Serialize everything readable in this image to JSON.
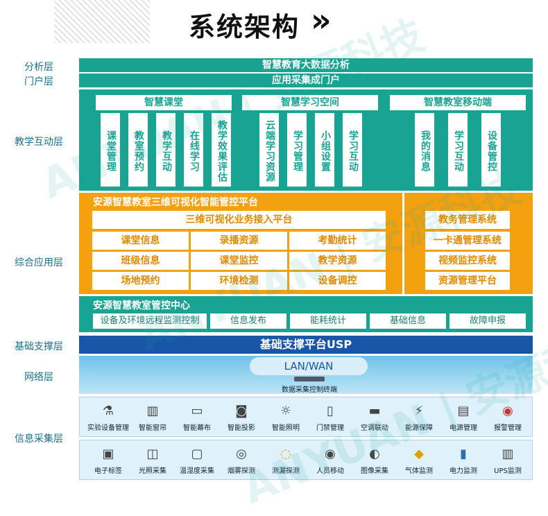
{
  "title": "系统架构",
  "title_arrow": "»",
  "watermark": "ANYUAN | 安源科技",
  "layers": {
    "analysis": "分析层",
    "portal": "门户层",
    "teaching": "教学互动层",
    "app": "综合应用层",
    "base": "基础支撑层",
    "network": "网络层",
    "info": "信息采集层"
  },
  "analysis_bar": "智慧教育大数据分析",
  "portal_bar": "应用采集成门户",
  "teaching": {
    "groups": [
      {
        "title": "智慧课堂",
        "items": [
          "课堂管理",
          "教室预约",
          "教学互动",
          "在线学习",
          "教学效果评估"
        ]
      },
      {
        "title": "智慧学习空间",
        "items": [
          "云端学习资源",
          "学习管理",
          "小组设置",
          "学习互动"
        ]
      },
      {
        "title": "智慧教室移动端",
        "items": [
          "我的消息",
          "学习互动",
          "设备管控"
        ]
      }
    ]
  },
  "platform3d": {
    "title": "安源智慧教室三维可视化智能管控平台",
    "access": "三维可视化业务接入平台",
    "grid": [
      [
        "课堂信息",
        "录播资源",
        "考勤统计"
      ],
      [
        "班级信息",
        "课堂监控",
        "教学资源"
      ],
      [
        "场地预约",
        "环境检测",
        "设备调控"
      ]
    ],
    "systems": [
      "教务管理系统",
      "一卡通管理系统",
      "视频监控系统",
      "资源管理平台"
    ]
  },
  "control_center": {
    "title": "安源智慧教室管控中心",
    "items": [
      "设备及环境远程监测控制",
      "信息发布",
      "能耗统计",
      "基础信息",
      "故障申报"
    ]
  },
  "usp": "基础支撑平台USP",
  "network": {
    "lan": "LAN/WAN",
    "terminal": "数据采集控制终端"
  },
  "devices_row1": [
    {
      "label": "实验设备管理",
      "icon": "lab-icon"
    },
    {
      "label": "智能窗帘",
      "icon": "curtain-icon"
    },
    {
      "label": "智能幕布",
      "icon": "screen-icon"
    },
    {
      "label": "智能投影",
      "icon": "projector-icon"
    },
    {
      "label": "智能照明",
      "icon": "light-icon"
    },
    {
      "label": "门禁管理",
      "icon": "door-icon"
    },
    {
      "label": "空调联动",
      "icon": "aircon-icon"
    },
    {
      "label": "能源保障",
      "icon": "energy-icon"
    },
    {
      "label": "电源管理",
      "icon": "power-icon"
    },
    {
      "label": "报警管理",
      "icon": "alarm-icon"
    }
  ],
  "devices_row2": [
    {
      "label": "电子标签",
      "icon": "tag-icon"
    },
    {
      "label": "光照采集",
      "icon": "light-sensor-icon"
    },
    {
      "label": "温湿度采集",
      "icon": "thermo-icon"
    },
    {
      "label": "烟雾探测",
      "icon": "smoke-icon"
    },
    {
      "label": "测漏探测",
      "icon": "leak-icon"
    },
    {
      "label": "人员移动",
      "icon": "motion-icon"
    },
    {
      "label": "图像采集",
      "icon": "camera-icon"
    },
    {
      "label": "气体监测",
      "icon": "gas-icon"
    },
    {
      "label": "电力监测",
      "icon": "meter-icon"
    },
    {
      "label": "UPS监测",
      "icon": "ups-icon"
    }
  ]
}
